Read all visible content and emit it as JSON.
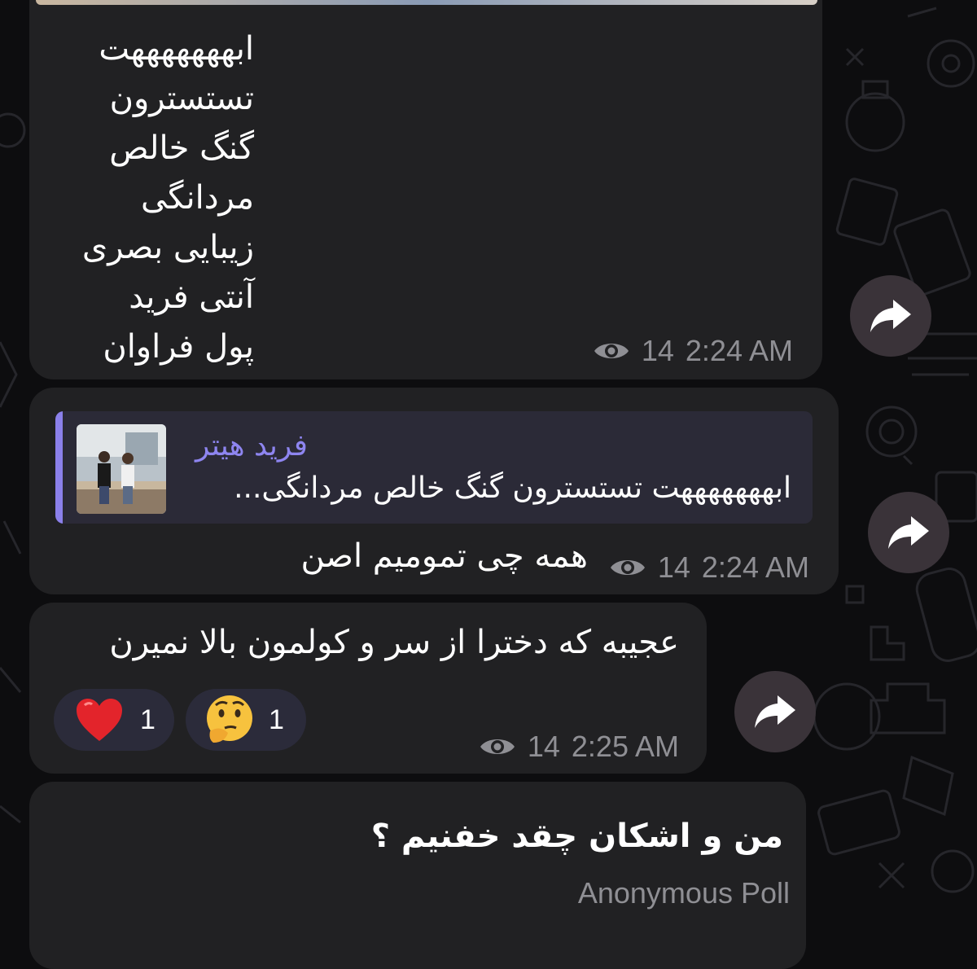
{
  "colors": {
    "background": "#0d0d0f",
    "bubble": "#212123",
    "reply_accent": "#8b80ea",
    "meta_text": "#8f8f94",
    "forward_button": "#3a3339"
  },
  "messages": [
    {
      "lines": [
        "ابهههههههت",
        "تستسترون",
        "گنگ خالص",
        "مردانگی",
        "زیبایی بصری",
        "آنتی فرید",
        "پول فراوان"
      ],
      "views": "14",
      "time": "2:24 AM"
    },
    {
      "reply": {
        "sender": "فرید هیتر",
        "quote": "ابهههههههت  تستسترون  گنگ خالص  مردانگی..."
      },
      "text": "همه چی تمومیم اصن",
      "views": "14",
      "time": "2:24 AM"
    },
    {
      "text": "عجیبه که دخترا از سر و کولمون بالا نمیرن",
      "reactions": [
        {
          "emoji": "heart",
          "count": "1"
        },
        {
          "emoji": "thinking-face",
          "count": "1"
        }
      ],
      "views": "14",
      "time": "2:25 AM"
    },
    {
      "poll_question": "من و اشکان چقد خفنیم ؟",
      "poll_type": "Anonymous Poll"
    }
  ],
  "icons": {
    "views": "eye-icon",
    "forward": "share-arrow-icon"
  }
}
